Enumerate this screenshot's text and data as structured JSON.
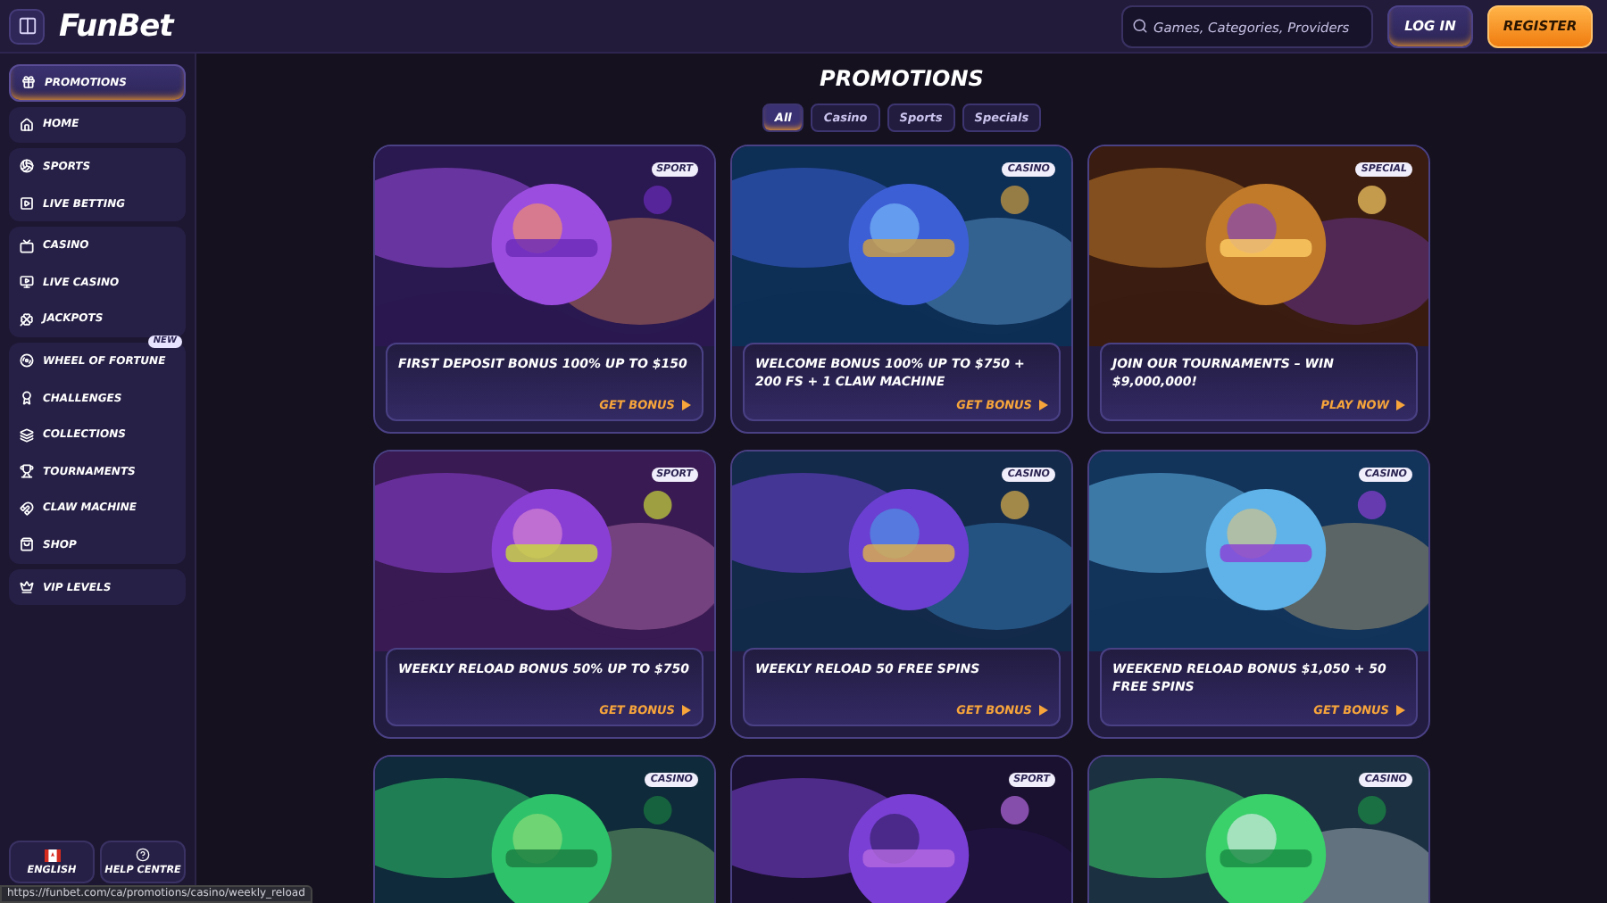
{
  "header": {
    "logo": "FunBet",
    "search": {
      "placeholder": "Games, Categories, Providers"
    },
    "buttons": [
      {
        "label": "LOG IN",
        "kind": "secondary"
      },
      {
        "label": "REGISTER",
        "kind": "primary"
      }
    ]
  },
  "sidebar": {
    "groups": [
      {
        "items": [
          {
            "label": "PROMOTIONS",
            "selected": true
          }
        ]
      },
      {
        "items": [
          {
            "label": "HOME",
            "selected": false
          }
        ]
      },
      {
        "items": [
          {
            "label": "SPORTS",
            "selected": false
          },
          {
            "label": "LIVE BETTING",
            "selected": false
          }
        ]
      },
      {
        "items": [
          {
            "label": "CASINO",
            "selected": false
          },
          {
            "label": "LIVE CASINO",
            "selected": false
          },
          {
            "label": "JACKPOTS",
            "selected": false
          }
        ]
      },
      {
        "items": [
          {
            "label": "WHEEL OF FORTUNE",
            "selected": false,
            "badge": "NEW"
          },
          {
            "label": "CHALLENGES",
            "selected": false
          },
          {
            "label": "COLLECTIONS",
            "selected": false
          },
          {
            "label": "TOURNAMENTS",
            "selected": false
          },
          {
            "label": "CLAW MACHINE",
            "selected": false
          },
          {
            "label": "SHOP",
            "selected": false
          }
        ]
      },
      {
        "items": [
          {
            "label": "VIP LEVELS",
            "selected": false
          }
        ]
      }
    ],
    "footer": [
      {
        "label": "ENGLISH",
        "kind": "language"
      },
      {
        "label": "HELP CENTRE",
        "kind": "help"
      }
    ]
  },
  "page_title": "PROMOTIONS",
  "filters": [
    {
      "label": "All",
      "selected": true
    },
    {
      "label": "Casino",
      "selected": false
    },
    {
      "label": "Sports",
      "selected": false
    },
    {
      "label": "Specials",
      "selected": false
    }
  ],
  "promotions": [
    {
      "tag": "SPORT",
      "title": "FIRST DEPOSIT BONUS 100% UP TO $150",
      "action": "GET BONUS"
    },
    {
      "tag": "CASINO",
      "title": "WELCOME BONUS 100% UP TO $750 + 200 FS + 1 CLAW MACHINE",
      "action": "GET BONUS"
    },
    {
      "tag": "SPECIAL",
      "title": "JOIN OUR TOURNAMENTS – WIN $9,000,000!",
      "action": "PLAY NOW"
    },
    {
      "tag": "SPORT",
      "title": "WEEKLY RELOAD BONUS 50% UP TO $750",
      "action": "GET BONUS"
    },
    {
      "tag": "CASINO",
      "title": "WEEKLY RELOAD 50 FREE SPINS",
      "action": "GET BONUS"
    },
    {
      "tag": "CASINO",
      "title": "WEEKEND RELOAD BONUS $1,050 + 50 FREE SPINS",
      "action": "GET BONUS"
    },
    {
      "tag": "CASINO"
    },
    {
      "tag": "SPORT"
    },
    {
      "tag": "CASINO"
    }
  ],
  "status_url": "https://funbet.com/ca/promotions/casino/weekly_reload"
}
